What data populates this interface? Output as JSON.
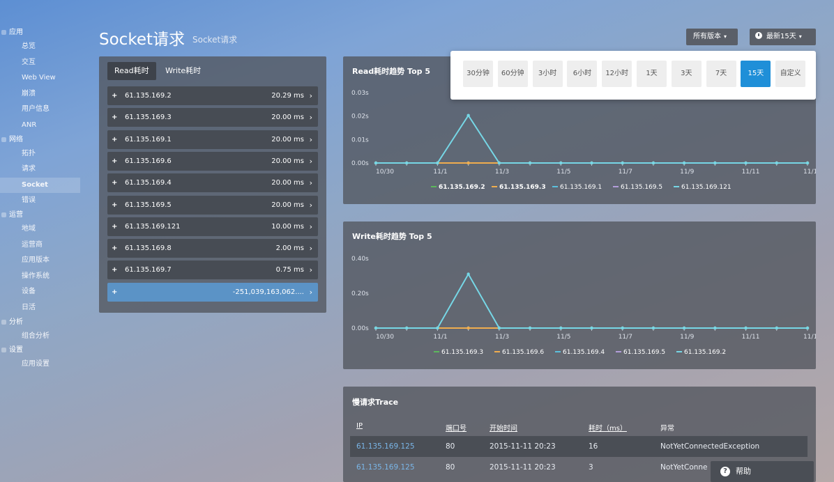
{
  "sidebar": {
    "groups": [
      {
        "label": "应用",
        "items": [
          "总览",
          "交互",
          "Web View",
          "崩溃",
          "用户信息",
          "ANR"
        ]
      },
      {
        "label": "网络",
        "items": [
          "拓扑",
          "请求",
          "Socket",
          "错误"
        ]
      },
      {
        "label": "运营",
        "items": [
          "地域",
          "运营商",
          "应用版本",
          "操作系统",
          "设备",
          "日活"
        ]
      },
      {
        "label": "分析",
        "items": [
          "组合分析"
        ]
      },
      {
        "label": "设置",
        "items": [
          "应用设置"
        ]
      }
    ],
    "active": "Socket"
  },
  "header": {
    "title": "Socket请求",
    "subtitle": "Socket请求",
    "version_button": "所有版本",
    "time_button": "最新15天"
  },
  "time_options": [
    "30分钟",
    "60分钟",
    "3小时",
    "6小时",
    "12小时",
    "1天",
    "3天",
    "7天",
    "15天",
    "自定义"
  ],
  "time_selected": "15天",
  "left_panel": {
    "tabs": [
      "Read耗时",
      "Write耗时"
    ],
    "active_tab": "Read耗时",
    "rows": [
      {
        "ip": "61.135.169.2",
        "value": "20.29 ms"
      },
      {
        "ip": "61.135.169.3",
        "value": "20.00 ms"
      },
      {
        "ip": "61.135.169.1",
        "value": "20.00 ms"
      },
      {
        "ip": "61.135.169.6",
        "value": "20.00 ms"
      },
      {
        "ip": "61.135.169.4",
        "value": "20.00 ms"
      },
      {
        "ip": "61.135.169.5",
        "value": "20.00 ms"
      },
      {
        "ip": "61.135.169.121",
        "value": "10.00 ms"
      },
      {
        "ip": "61.135.169.8",
        "value": "2.00 ms"
      },
      {
        "ip": "61.135.169.7",
        "value": "0.75 ms"
      },
      {
        "ip": "",
        "value": "-251,039,163,062...."
      }
    ]
  },
  "read_panel_title": "Read耗时趋势 Top 5",
  "write_panel_title": "Write耗时趋势 Top 5",
  "chart_data": [
    {
      "type": "line",
      "title": "Read耗时趋势 Top 5",
      "x": [
        "10/30",
        "10/31",
        "11/1",
        "11/2",
        "11/3",
        "11/4",
        "11/5",
        "11/6",
        "11/7",
        "11/8",
        "11/9",
        "11/10",
        "11/11",
        "11/12",
        "11/13"
      ],
      "x_tick_labels": [
        "10/30",
        "11/1",
        "11/3",
        "11/5",
        "11/7",
        "11/9",
        "11/11",
        "11/13"
      ],
      "y_tick_labels": [
        "0.03s",
        "0.02s",
        "0.01s",
        "0.00s"
      ],
      "ylim": [
        0,
        0.03
      ],
      "series": [
        {
          "name": "61.135.169.2",
          "color": "#5cb85c",
          "values": [
            0,
            0,
            0,
            0.0203,
            0,
            0,
            0,
            0,
            0,
            0,
            0,
            0,
            0,
            0,
            0
          ]
        },
        {
          "name": "61.135.169.3",
          "color": "#f0ad4e",
          "values": [
            0,
            0,
            0,
            0,
            0,
            0,
            0,
            0,
            0,
            0,
            0,
            0,
            0,
            0,
            0
          ]
        },
        {
          "name": "61.135.169.1",
          "color": "#5bc0de",
          "values": [
            0,
            0,
            0,
            0,
            0,
            0,
            0,
            0,
            0,
            0,
            0,
            0,
            0,
            0,
            0
          ]
        },
        {
          "name": "61.135.169.5",
          "color": "#b39ddb",
          "values": [
            0,
            0,
            0,
            0,
            0,
            0,
            0,
            0,
            0,
            0,
            0,
            0,
            0,
            0,
            0
          ]
        },
        {
          "name": "61.135.169.121",
          "color": "#76d7e6",
          "values": [
            0,
            0,
            0,
            0,
            0,
            0,
            0,
            0,
            0,
            0,
            0,
            0,
            0,
            0,
            0
          ]
        }
      ],
      "legend_bold": [
        "61.135.169.2",
        "61.135.169.3"
      ],
      "legend_position": "bottom"
    },
    {
      "type": "line",
      "title": "Write耗时趋势 Top 5",
      "x": [
        "10/30",
        "10/31",
        "11/1",
        "11/2",
        "11/3",
        "11/4",
        "11/5",
        "11/6",
        "11/7",
        "11/8",
        "11/9",
        "11/10",
        "11/11",
        "11/12",
        "11/13"
      ],
      "x_tick_labels": [
        "10/30",
        "11/1",
        "11/3",
        "11/5",
        "11/7",
        "11/9",
        "11/11",
        "11/13"
      ],
      "y_tick_labels": [
        "0.40s",
        "0.20s",
        "0.00s"
      ],
      "ylim": [
        0,
        0.4
      ],
      "series": [
        {
          "name": "61.135.169.3",
          "color": "#5cb85c",
          "values": [
            0,
            0,
            0,
            0.31,
            0,
            0,
            0,
            0,
            0,
            0,
            0,
            0,
            0,
            0,
            0
          ]
        },
        {
          "name": "61.135.169.6",
          "color": "#f0ad4e",
          "values": [
            0,
            0,
            0,
            0,
            0,
            0,
            0,
            0,
            0,
            0,
            0,
            0,
            0,
            0,
            0
          ]
        },
        {
          "name": "61.135.169.4",
          "color": "#5bc0de",
          "values": [
            0,
            0,
            0,
            0,
            0,
            0,
            0,
            0,
            0,
            0,
            0,
            0,
            0,
            0,
            0
          ]
        },
        {
          "name": "61.135.169.5",
          "color": "#b39ddb",
          "values": [
            0,
            0,
            0,
            0,
            0,
            0,
            0,
            0,
            0,
            0,
            0,
            0,
            0,
            0,
            0
          ]
        },
        {
          "name": "61.135.169.2",
          "color": "#76d7e6",
          "values": [
            0,
            0,
            0,
            0,
            0,
            0,
            0,
            0,
            0,
            0,
            0,
            0,
            0,
            0,
            0
          ]
        }
      ],
      "legend_bold": [],
      "legend_position": "bottom"
    }
  ],
  "trace": {
    "title": "慢请求Trace",
    "headers": [
      "IP",
      "端口号",
      "开始时间",
      "耗时（ms）",
      "异常"
    ],
    "rows": [
      {
        "ip": "61.135.169.125",
        "port": "80",
        "start": "2015-11-11 20:23",
        "duration": "16",
        "exception": "NotYetConnectedException"
      },
      {
        "ip": "61.135.169.125",
        "port": "80",
        "start": "2015-11-11 20:23",
        "duration": "3",
        "exception": "NotYetConne"
      }
    ]
  },
  "help_label": "帮助"
}
